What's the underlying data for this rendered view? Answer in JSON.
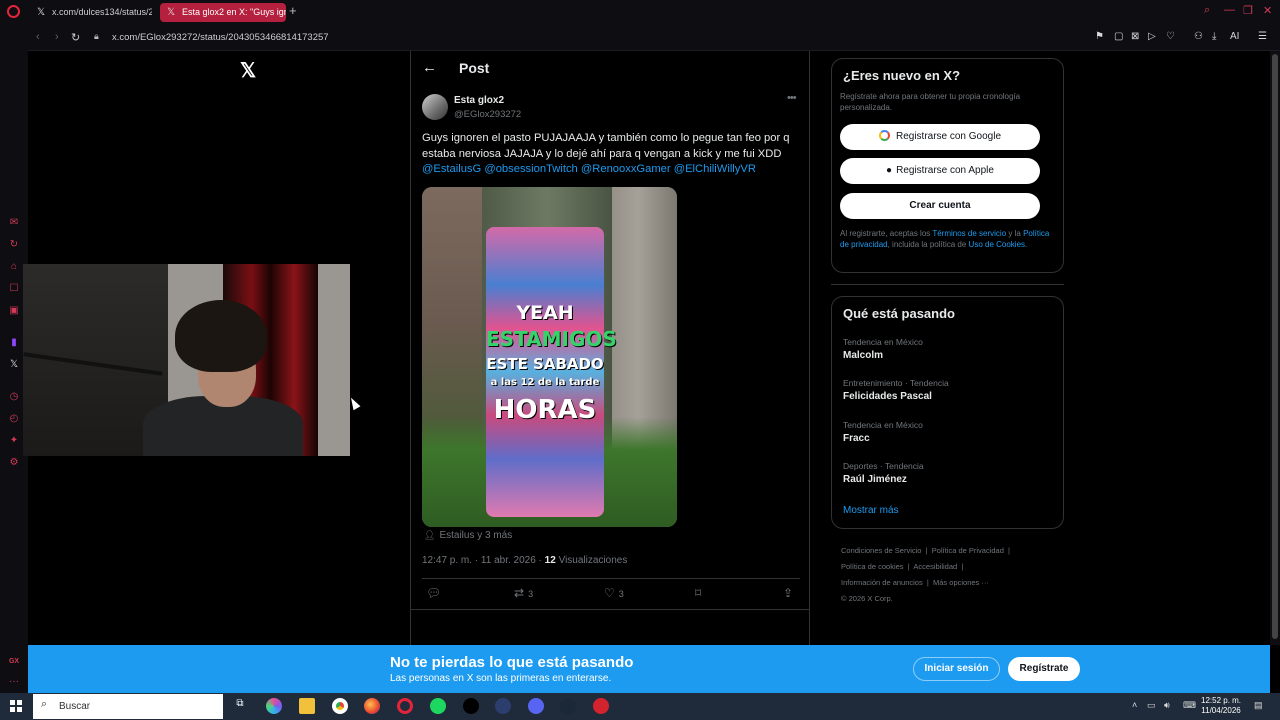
{
  "browser": {
    "tabs": [
      {
        "title": "x.com/dulces134/status/2..."
      },
      {
        "title": "Esta glox2 en X: \"Guys ign"
      }
    ],
    "url": "x.com/EGlox293272/status/2043053466814173257"
  },
  "x_page": {
    "header": {
      "title": "Post"
    },
    "tweet": {
      "author_name": "Esta glox2",
      "author_handle": "@EGlox293272",
      "text": "Guys ignoren el pasto PUJAJAAJA y también como lo pegue tan feo por q estaba nerviosa JAJAJA y lo dejé ahí para q vengan a kick y me fui XDD",
      "mentions": [
        "@EstailusG",
        "@obsessionTwitch",
        "@RenooxxGamer",
        "@ElChiliWillyVR"
      ],
      "image_text": [
        "YEAH",
        "ESTAMIGOS",
        "ESTE SABADO",
        "a las 12 de la tarde",
        "HORAS"
      ],
      "tagged": "Estailus y 3 más",
      "time": "12:47 p. m. · 11 abr. 2026 ·",
      "views_count": "12",
      "views_label": "Visualizaciones",
      "retweets": "3",
      "likes": "3"
    },
    "signup": {
      "title": "¿Eres nuevo en X?",
      "subtitle": "Regístrate ahora para obtener tu propia cronología personalizada.",
      "google": "Registrarse con Google",
      "apple": "Registrarse con Apple",
      "create": "Crear cuenta",
      "legal_pre": "Al registrarte, aceptas los",
      "terms": "Términos de servicio",
      "legal_mid": "y la",
      "privacy": "Política de privacidad",
      "legal_mid2": ", incluida la política de",
      "cookies": "Uso de Cookies",
      "legal_end": "."
    },
    "trends": {
      "title": "Qué está pasando",
      "items": [
        {
          "category": "Tendencia en México",
          "name": "Malcolm"
        },
        {
          "category": "Entretenimiento · Tendencia",
          "name": "Felicidades Pascal"
        },
        {
          "category": "Tendencia en México",
          "name": "Fracc"
        },
        {
          "category": "Deportes · Tendencia",
          "name": "Raúl Jiménez"
        }
      ],
      "show_more": "Mostrar más"
    },
    "footer": {
      "links": [
        "Condiciones de Servicio",
        "Política de Privacidad",
        "Política de cookies",
        "Accesibilidad",
        "Información de anuncios",
        "Más opciones ···"
      ],
      "copyright": "© 2026 X Corp."
    },
    "banner": {
      "title": "No te pierdas lo que está pasando",
      "subtitle": "Las personas en X son las primeras en enterarse.",
      "login": "Iniciar sesión",
      "register": "Regístrate"
    }
  },
  "taskbar": {
    "search_placeholder": "Buscar",
    "time": "12:52 p. m.",
    "date": "11/04/2026"
  },
  "colors": {
    "x_blue": "#1d9bf0",
    "opera_red": "#e3243b",
    "active_tab": "#b4203d"
  }
}
